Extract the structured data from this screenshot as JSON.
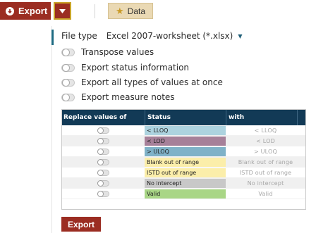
{
  "toolbar": {
    "export_label": "Export",
    "data_label": "Data"
  },
  "export_panel": {
    "file_type_label": "File type",
    "file_type_value": "Excel 2007-worksheet (*.xlsx)",
    "options": [
      {
        "label": "Transpose values",
        "checked": false
      },
      {
        "label": "Export status information",
        "checked": false
      },
      {
        "label": "Export all types of values at once",
        "checked": false
      },
      {
        "label": "Export measure notes",
        "checked": false
      }
    ],
    "table": {
      "headers": [
        "Replace values of",
        "Status",
        "with"
      ],
      "rows": [
        {
          "status": "< LLOQ",
          "with": "< LLOQ",
          "color": "#add3df"
        },
        {
          "status": "< LOD",
          "with": "< LOD",
          "color": "#a68099"
        },
        {
          "status": "> ULOQ",
          "with": "> ULOQ",
          "color": "#7fb2c8"
        },
        {
          "status": "Blank out of range",
          "with": "Blank out of range",
          "color": "#fbeeaa"
        },
        {
          "status": "ISTD out of range",
          "with": "ISTD out of range",
          "color": "#fbeeaa"
        },
        {
          "status": "No intercept",
          "with": "No intercept",
          "color": "#c8c8c8"
        },
        {
          "status": "Valid",
          "with": "Valid",
          "color": "#a9d686"
        }
      ]
    },
    "export_button_label": "Export"
  },
  "colors": {
    "brand_red": "#9b2d22",
    "header_navy": "#123a56",
    "data_button": "#ead9b4",
    "focus_border": "#c9a227"
  },
  "icons": [
    "download-icon",
    "caret-down-icon",
    "star-icon",
    "toggle-switch"
  ]
}
